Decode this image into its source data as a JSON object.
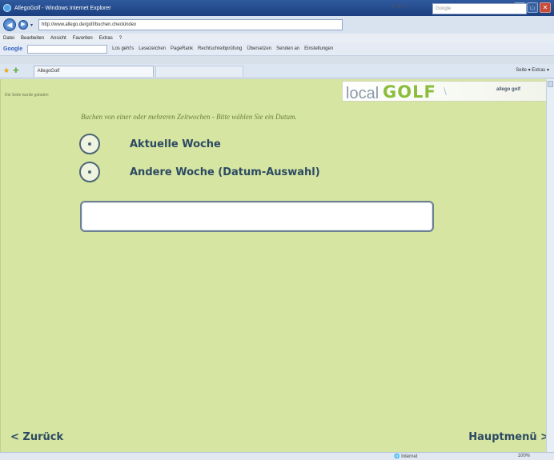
{
  "window": {
    "title": "AllegoGolf - Windows Internet Explorer",
    "buttons": [
      "_",
      "□",
      "✕"
    ]
  },
  "addressbar": {
    "url": "http://www.allego.de/golf/buchen.checkindex",
    "search_placeholder": "Google"
  },
  "menubar": {
    "items": [
      "Datei",
      "Bearbeiten",
      "Ansicht",
      "Favoriten",
      "Extras",
      "?"
    ]
  },
  "google_toolbar": {
    "logo": "Google",
    "items": [
      "Los geht's",
      "Lesezeichen",
      "PageRank",
      "Rechtschreibprüfung",
      "Übersetzen",
      "Senden an",
      "Einstellungen"
    ]
  },
  "tabbar": {
    "tab_label": "AllegoGolf",
    "commands": "Seite ▾  Extras ▾"
  },
  "page": {
    "loaded_text": "Die Seite wurde geladen",
    "logo_local": "local",
    "logo_golf": "GOLF",
    "logo_brand": "allego golf",
    "instruction": "Buchen von einer oder mehreren Zeitwochen - Bitte wählen Sie ein Datum.",
    "options": [
      {
        "label": "Aktuelle Woche"
      },
      {
        "label": "Andere Woche (Datum-Auswahl)"
      }
    ],
    "date_field_value": "",
    "back_label": "< Zurück",
    "main_menu_label": "Hauptmenü >"
  },
  "statusbar": {
    "zone": "Internet",
    "zoom": "100%"
  }
}
